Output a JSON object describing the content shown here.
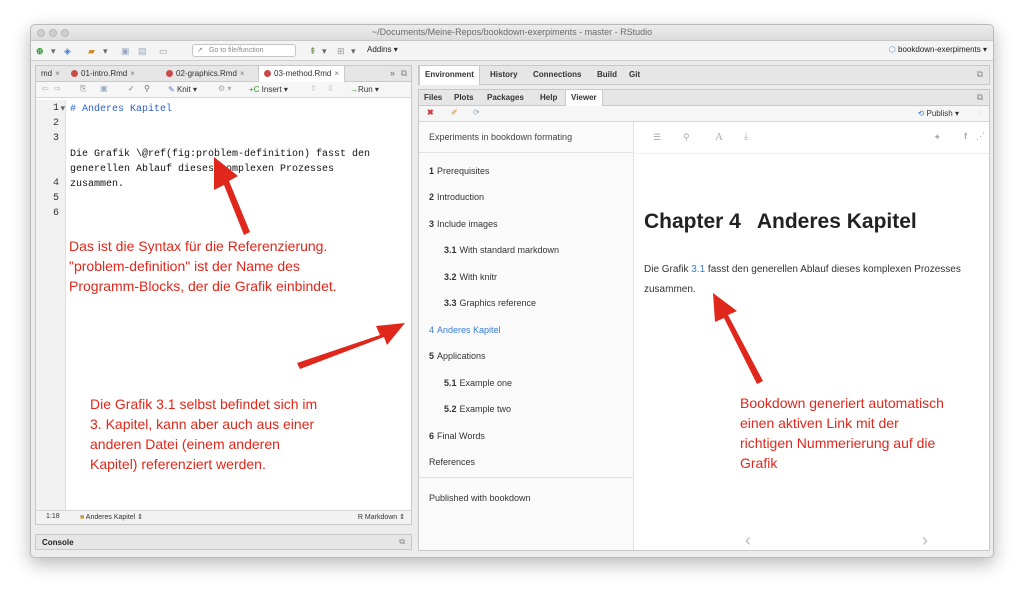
{
  "window": {
    "title": "~/Documents/Meine-Repos/bookdown-exerpiments - master - RStudio",
    "toolbar": {
      "goto_placeholder": "Go to file/function",
      "addins": "Addins",
      "project": "bookdown-exerpiments"
    }
  },
  "editor": {
    "tabs": [
      {
        "label": "md"
      },
      {
        "label": "01-intro.Rmd"
      },
      {
        "label": "02-graphics.Rmd"
      },
      {
        "label": "03-method.Rmd"
      }
    ],
    "toolbar": {
      "knit": "Knit",
      "insert": "Insert",
      "run": "Run"
    },
    "line_numbers": [
      "1",
      "2",
      "3",
      "4",
      "5",
      "6"
    ],
    "lines": {
      "l1": "# Anderes Kapitel",
      "l3a": "Die Grafik \\@ref(fig:problem-definition) fasst den",
      "l3b": "generellen Ablauf dieses komplexen Prozesses",
      "l3c": "zusammen."
    },
    "status": {
      "position": "1:18",
      "section": "Anderes Kapitel",
      "mode": "R Markdown"
    },
    "console": "Console"
  },
  "env_pane": {
    "tabs": [
      "Environment",
      "History",
      "Connections",
      "Build",
      "Git"
    ]
  },
  "viewer_pane": {
    "tabs": [
      "Files",
      "Plots",
      "Packages",
      "Help",
      "Viewer"
    ],
    "publish": "Publish"
  },
  "book": {
    "toc_title": "Experiments in bookdown formating",
    "toc": [
      {
        "num": "1",
        "label": "Prerequisites",
        "level": 1
      },
      {
        "num": "2",
        "label": "Introduction",
        "level": 1
      },
      {
        "num": "3",
        "label": "Include images",
        "level": 1
      },
      {
        "num": "3.1",
        "label": "With standard markdown",
        "level": 2
      },
      {
        "num": "3.2",
        "label": "With knitr",
        "level": 2
      },
      {
        "num": "3.3",
        "label": "Graphics reference",
        "level": 2
      },
      {
        "num": "4",
        "label": "Anderes Kapitel",
        "level": 1
      },
      {
        "num": "5",
        "label": "Applications",
        "level": 1
      },
      {
        "num": "5.1",
        "label": "Example one",
        "level": 2
      },
      {
        "num": "5.2",
        "label": "Example two",
        "level": 2
      },
      {
        "num": "6",
        "label": "Final Words",
        "level": 1
      }
    ],
    "references": "References",
    "published": "Published with bookdown",
    "chapter_num": "Chapter 4",
    "chapter_title": "Anderes Kapitel",
    "para_before": "Die Grafik ",
    "para_link": "3.1",
    "para_after": " fasst den generellen Ablauf dieses komplexen Prozesses zusammen."
  },
  "annotations": {
    "a1": [
      "Das ist die Syntax für die Referenzierung.",
      "\"problem-definition\" ist der Name des",
      "Programm-Blocks, der die Grafik einbindet."
    ],
    "a2": [
      "Die Grafik 3.1 selbst befindet sich im",
      "3. Kapitel, kann aber auch aus einer",
      "anderen Datei (einem anderen",
      "Kapitel) referenziert werden."
    ],
    "a3": [
      "Bookdown generiert automatisch",
      "einen aktiven Link mit der",
      "richtigen Nummerierung auf die",
      "Grafik"
    ]
  },
  "colors": {
    "annotation": "#e0271b",
    "link": "#3b7bd6",
    "heading_code": "#2f5fd3"
  }
}
